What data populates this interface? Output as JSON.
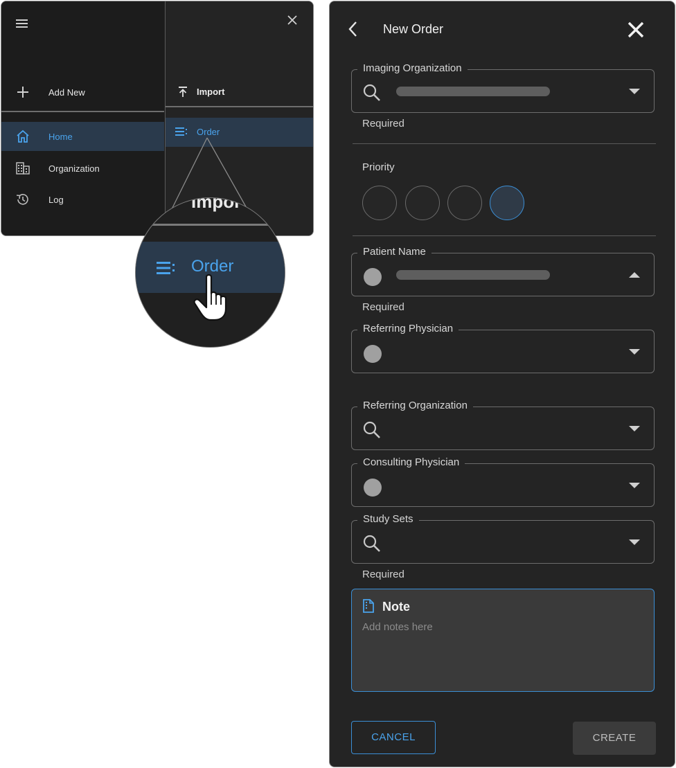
{
  "menu": {
    "add_new_label": "Add New",
    "nav_items": [
      {
        "label": "Home",
        "icon": "home-icon",
        "active": true
      },
      {
        "label": "Organization",
        "icon": "building-icon",
        "active": false
      },
      {
        "label": "Log",
        "icon": "history-icon",
        "active": false
      }
    ],
    "submenu": {
      "import_label": "Import",
      "order_label": "Order"
    }
  },
  "magnifier": {
    "import_label_partial": "Impor",
    "order_label": "Order"
  },
  "dialog": {
    "title": "New Order",
    "fields": {
      "imaging_org": {
        "label": "Imaging Organization",
        "helper": "Required"
      },
      "priority": {
        "label": "Priority",
        "options": 4,
        "selected_index": 3
      },
      "patient_name": {
        "label": "Patient Name",
        "helper": "Required"
      },
      "referring_physician": {
        "label": "Referring Physician"
      },
      "referring_org": {
        "label": "Referring Organization"
      },
      "consulting_physician": {
        "label": "Consulting Physician"
      },
      "study_sets": {
        "label": "Study Sets",
        "helper": "Required"
      }
    },
    "note": {
      "title": "Note",
      "placeholder": "Add notes here"
    },
    "buttons": {
      "cancel": "CANCEL",
      "create": "CREATE"
    }
  },
  "colors": {
    "accent": "#4aa3ec",
    "panel_bg": "#242424",
    "selected_row": "#2a3a4c"
  }
}
